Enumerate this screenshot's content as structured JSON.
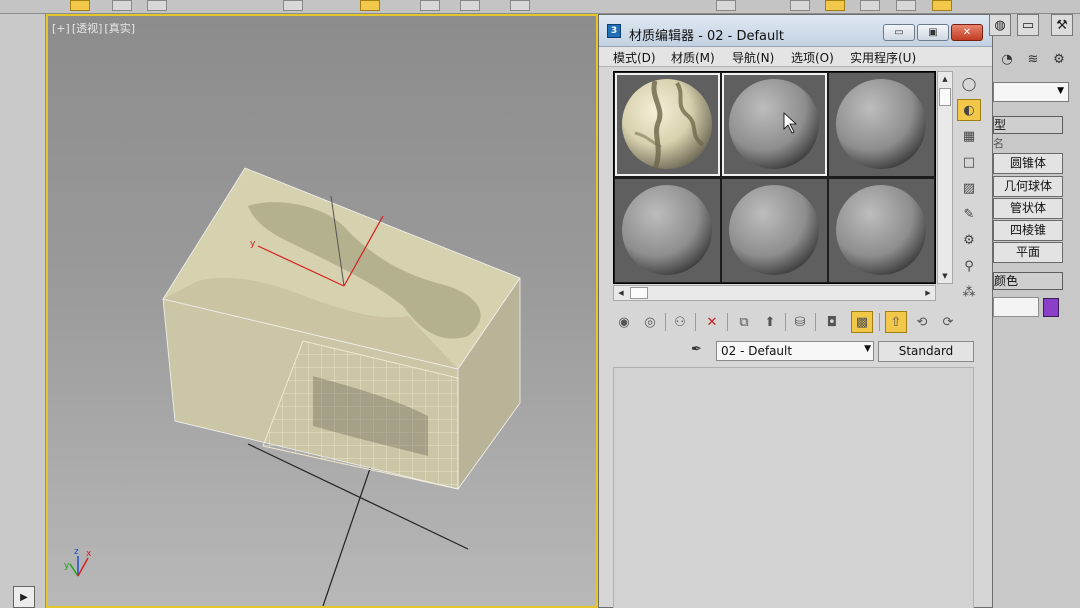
{
  "viewport": {
    "labels": [
      "[+]",
      "[透视]",
      "[真实]"
    ],
    "axis_labels": [
      "x",
      "y",
      "z"
    ]
  },
  "material_editor": {
    "title": "材质编辑器 - 02 - Default",
    "window_buttons": [
      "▭",
      "▣",
      "✕"
    ],
    "menu": [
      "模式(D)",
      "材质(M)",
      "导航(N)",
      "选项(O)",
      "实用程序(U)"
    ],
    "slots": [
      {
        "material": "textured-marble",
        "active": true
      },
      {
        "material": "standard-gray",
        "active": true
      },
      {
        "material": "standard-gray",
        "active": false
      },
      {
        "material": "standard-gray",
        "active": false
      },
      {
        "material": "standard-gray",
        "active": false
      },
      {
        "material": "standard-gray",
        "active": false
      }
    ],
    "material_name": "02 - Default",
    "material_type": "Standard",
    "colors": {
      "accent": "#f2c84b",
      "title_bar": "#c3d2e3",
      "close": "#c23c24"
    }
  },
  "command_panel": {
    "section_title": "型",
    "sub_label": "名",
    "buttons": [
      "圆锥体",
      "几何球体",
      "管状体",
      "四棱锥",
      "平面"
    ],
    "color_section": "颜色",
    "swatch_color": "#8b3fc8"
  }
}
